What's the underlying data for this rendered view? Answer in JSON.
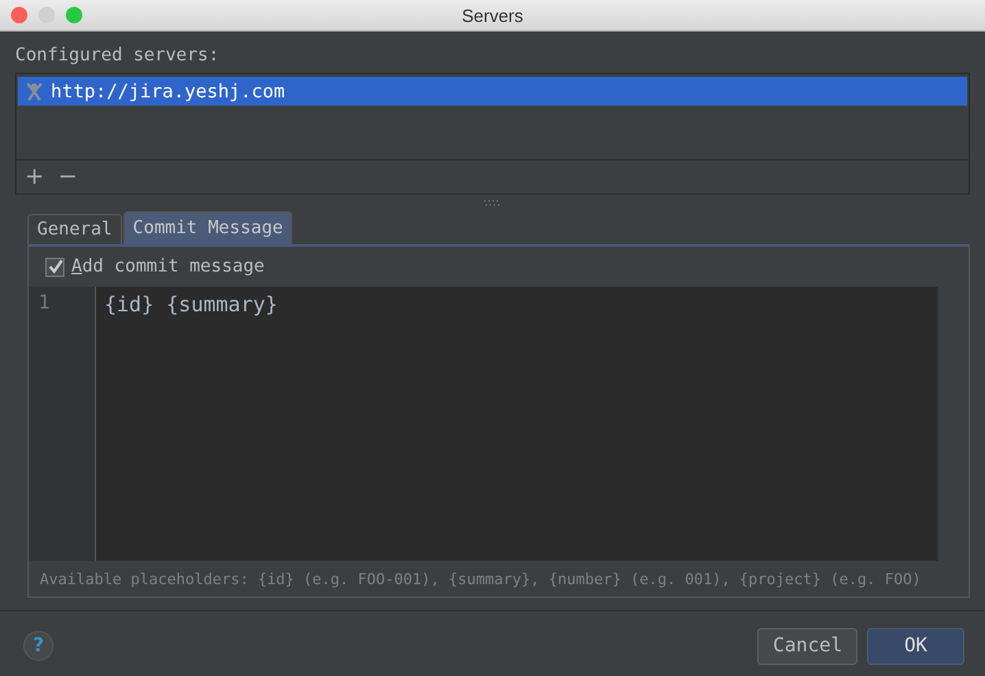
{
  "window": {
    "title": "Servers"
  },
  "servers": {
    "label": "Configured servers:",
    "items": [
      {
        "url": "http://jira.yeshj.com",
        "selected": true
      }
    ],
    "toolbar": [
      "+",
      "−"
    ]
  },
  "tabs": [
    {
      "label": "General",
      "selected": false
    },
    {
      "label": "Commit Message",
      "selected": true
    }
  ],
  "commit_message": {
    "checkbox": {
      "label": "Add commit message",
      "checked": true
    },
    "editor": {
      "lines": [
        {
          "number": "1",
          "text": "{id} {summary}"
        }
      ]
    },
    "hint": "Available placeholders: {id} (e.g. FOO-001), {summary}, {number} (e.g. 001), {project} (e.g. FOO)"
  },
  "help": "?",
  "buttons": [
    {
      "label": "Cancel",
      "kind": "secondary"
    },
    {
      "label": "OK",
      "kind": "default"
    }
  ]
}
